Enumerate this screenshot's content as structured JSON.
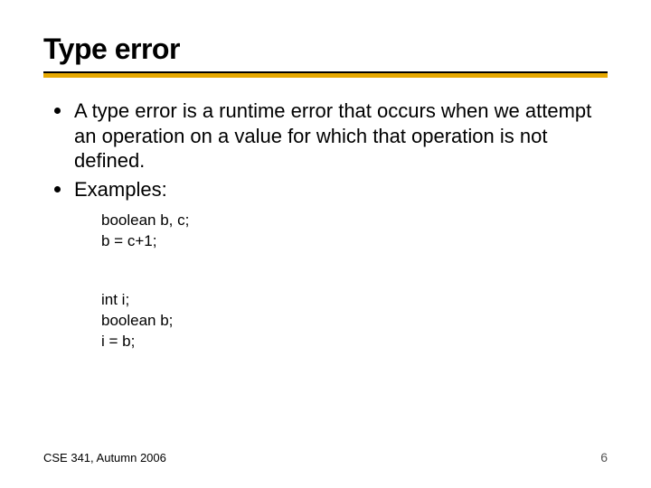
{
  "title": "Type error",
  "bullets": [
    "A type error is a runtime error that occurs when we attempt an operation on a value for which that operation is not defined.",
    "Examples:"
  ],
  "code1": {
    "line1": "boolean b, c;",
    "line2": "b = c+1;"
  },
  "code2": {
    "line1": "int i;",
    "line2": "boolean b;",
    "line3": "i = b;"
  },
  "footer": "CSE 341, Autumn 2006",
  "page": "6"
}
